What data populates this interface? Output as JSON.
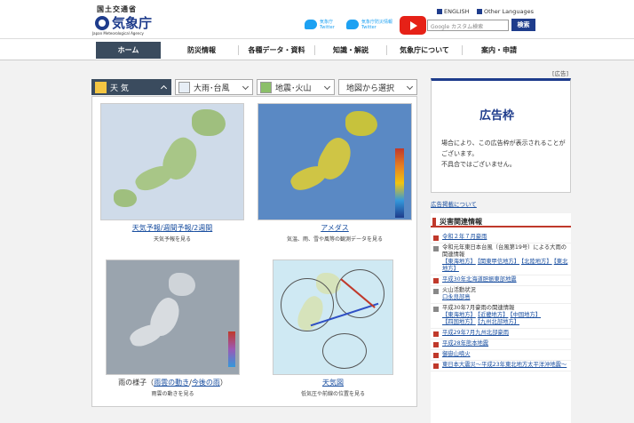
{
  "header": {
    "ministry": "国土交通省",
    "agency": "気象庁",
    "agency_en": "Japan Meteorological Agency",
    "twitter1": [
      "気象庁",
      "Twitter"
    ],
    "twitter2": [
      "気象庁防災情報",
      "Twitter"
    ],
    "lang_en": "ENGLISH",
    "lang_other": "Other Languages",
    "search_placeholder": "Google カスタム検索",
    "search_button": "検索"
  },
  "nav": [
    "ホーム",
    "防災情報",
    "各種データ・資料",
    "知識・解説",
    "気象庁について",
    "案内・申請"
  ],
  "ad_label": "[広告]",
  "tabs": [
    "天 気",
    "大雨･台風",
    "地震･火山",
    "地図から選択"
  ],
  "panels": {
    "weather": {
      "links": [
        "天気予報",
        "週間予報",
        "2週間"
      ],
      "sep": "/",
      "desc": "天気予報を見る"
    },
    "amedas": {
      "link": "アメダス",
      "desc": "気温、雨、雪や風等の観測データを見る"
    },
    "rain": {
      "text": "雨の様子（",
      "link1": "雨雲の動き",
      "sep": "/",
      "link2": "今後の雨",
      "close": "）",
      "desc": "雨雲の動きを見る"
    },
    "chart": {
      "link": "天気図",
      "desc": "低気圧や前線の位置を見る"
    }
  },
  "ad": {
    "title": "広告枠",
    "text": "場合により、この広告枠が表示されることがございます。",
    "text2": "不具合ではございません。",
    "link": "広告掲載について"
  },
  "disaster": {
    "title": "災害関連情報",
    "items": [
      {
        "text": "令和２年７月豪雨",
        "link": true
      },
      {
        "text": "令和元年東日本台風（台風第19号）による大雨の関連情報",
        "link": false,
        "sub": [
          "【東海地方】",
          "【関東甲信地方】",
          "【北陸地方】",
          "【東北地方】"
        ]
      },
      {
        "text": "平成30年北海道胆振東部地震",
        "link": true
      },
      {
        "text": "火山活動状況",
        "link": false,
        "sub": [
          "口永良部島"
        ]
      },
      {
        "text": "平成30年7月豪雨の関連情報",
        "link": false,
        "sub": [
          "【東海地方】",
          "【近畿地方】",
          "【中国地方】",
          "【四国地方】",
          "【九州北部地方】"
        ]
      },
      {
        "text": "平成29年7月九州北部豪雨",
        "link": true
      },
      {
        "text": "平成28年熊本地震",
        "link": true
      },
      {
        "text": "御嶽山噴火",
        "link": true
      },
      {
        "text": "東日本大震災〜平成23年東北地方太平洋沖地震〜",
        "link": true
      }
    ]
  },
  "colors": {
    "accent": "#1e3c8c",
    "nav_active": "#3a4b5e",
    "alert": "#c0392b"
  }
}
